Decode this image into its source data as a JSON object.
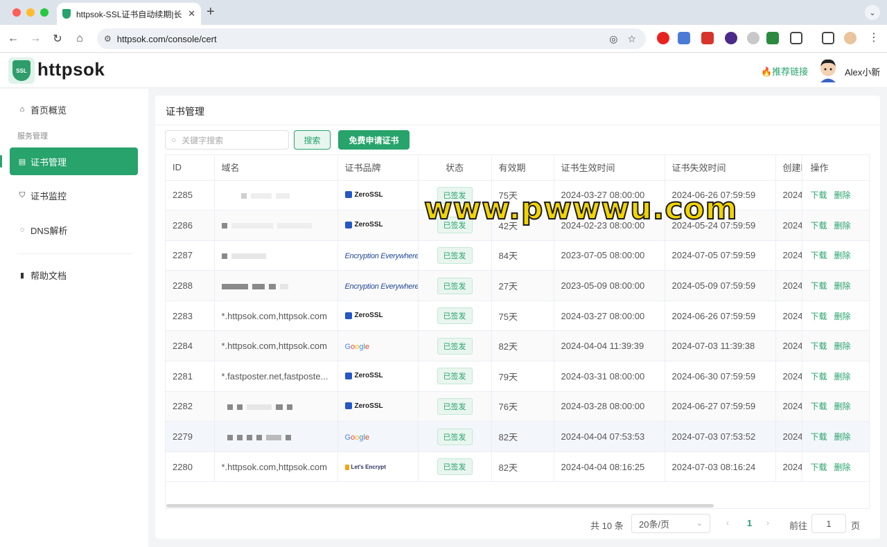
{
  "browser": {
    "tab_title": "httpsok-SSL证书自动续期|长效",
    "url": "httpsok.com/console/cert"
  },
  "header": {
    "logo_badge": "SSL",
    "logo_text": "httpsok",
    "recommend_link": "🔥推荐链接",
    "username": "Alex小新"
  },
  "sidebar": {
    "overview": "首页概览",
    "group_label": "服务管理",
    "cert_manage": "证书管理",
    "cert_monitor": "证书监控",
    "dns": "DNS解析",
    "help": "帮助文档"
  },
  "main": {
    "title": "证书管理",
    "search_placeholder": "关键字搜索",
    "search_button": "搜索",
    "apply_button": "免费申请证书"
  },
  "table": {
    "columns": [
      "ID",
      "域名",
      "证书品牌",
      "状态",
      "有效期",
      "证书生效时间",
      "证书失效时间",
      "创建时间",
      "操作"
    ],
    "rows": [
      {
        "id": "2285",
        "domain": "",
        "brand": "ZeroSSL",
        "status": "已签发",
        "validity": "75天",
        "start": "2024-03-27 08:00:00",
        "end": "2024-06-26 07:59:59",
        "created": "2024"
      },
      {
        "id": "2286",
        "domain": "",
        "brand": "ZeroSSL",
        "status": "已签发",
        "validity": "42天",
        "start": "2024-02-23 08:00:00",
        "end": "2024-05-24 07:59:59",
        "created": "2024"
      },
      {
        "id": "2287",
        "domain": "",
        "brand": "Encryption Everywhere™",
        "status": "已签发",
        "validity": "84天",
        "start": "2023-07-05 08:00:00",
        "end": "2024-07-05 07:59:59",
        "created": "2024"
      },
      {
        "id": "2288",
        "domain": "",
        "brand": "Encryption Everywhere™",
        "status": "已签发",
        "validity": "27天",
        "start": "2023-05-09 08:00:00",
        "end": "2024-05-09 07:59:59",
        "created": "2024"
      },
      {
        "id": "2283",
        "domain": "*.httpsok.com,httpsok.com",
        "brand": "ZeroSSL",
        "status": "已签发",
        "validity": "75天",
        "start": "2024-03-27 08:00:00",
        "end": "2024-06-26 07:59:59",
        "created": "2024"
      },
      {
        "id": "2284",
        "domain": "*.httpsok.com,httpsok.com",
        "brand": "Google",
        "status": "已签发",
        "validity": "82天",
        "start": "2024-04-04 11:39:39",
        "end": "2024-07-03 11:39:38",
        "created": "2024"
      },
      {
        "id": "2281",
        "domain": "*.fastposter.net,fastposte...",
        "brand": "ZeroSSL",
        "status": "已签发",
        "validity": "79天",
        "start": "2024-03-31 08:00:00",
        "end": "2024-06-30 07:59:59",
        "created": "2024"
      },
      {
        "id": "2282",
        "domain": "",
        "brand": "ZeroSSL",
        "status": "已签发",
        "validity": "76天",
        "start": "2024-03-28 08:00:00",
        "end": "2024-06-27 07:59:59",
        "created": "2024"
      },
      {
        "id": "2279",
        "domain": "",
        "brand": "Google",
        "status": "已签发",
        "validity": "82天",
        "start": "2024-04-04 07:53:53",
        "end": "2024-07-03 07:53:52",
        "created": "2024"
      },
      {
        "id": "2280",
        "domain": "*.httpsok.com,httpsok.com",
        "brand": "Let's Encrypt",
        "status": "已签发",
        "validity": "82天",
        "start": "2024-04-04 08:16:25",
        "end": "2024-07-03 08:16:24",
        "created": "2024"
      }
    ],
    "action_download": "下载",
    "action_delete": "删除"
  },
  "pagination": {
    "total": "共 10 条",
    "page_size": "20条/页",
    "current_page": "1",
    "goto_label": "前往",
    "goto_value": "1",
    "page_suffix": "页"
  },
  "watermark": "www.pwwwu.com",
  "colors": {
    "accent": "#27a36b",
    "badge_bg": "#e9f6ef"
  }
}
